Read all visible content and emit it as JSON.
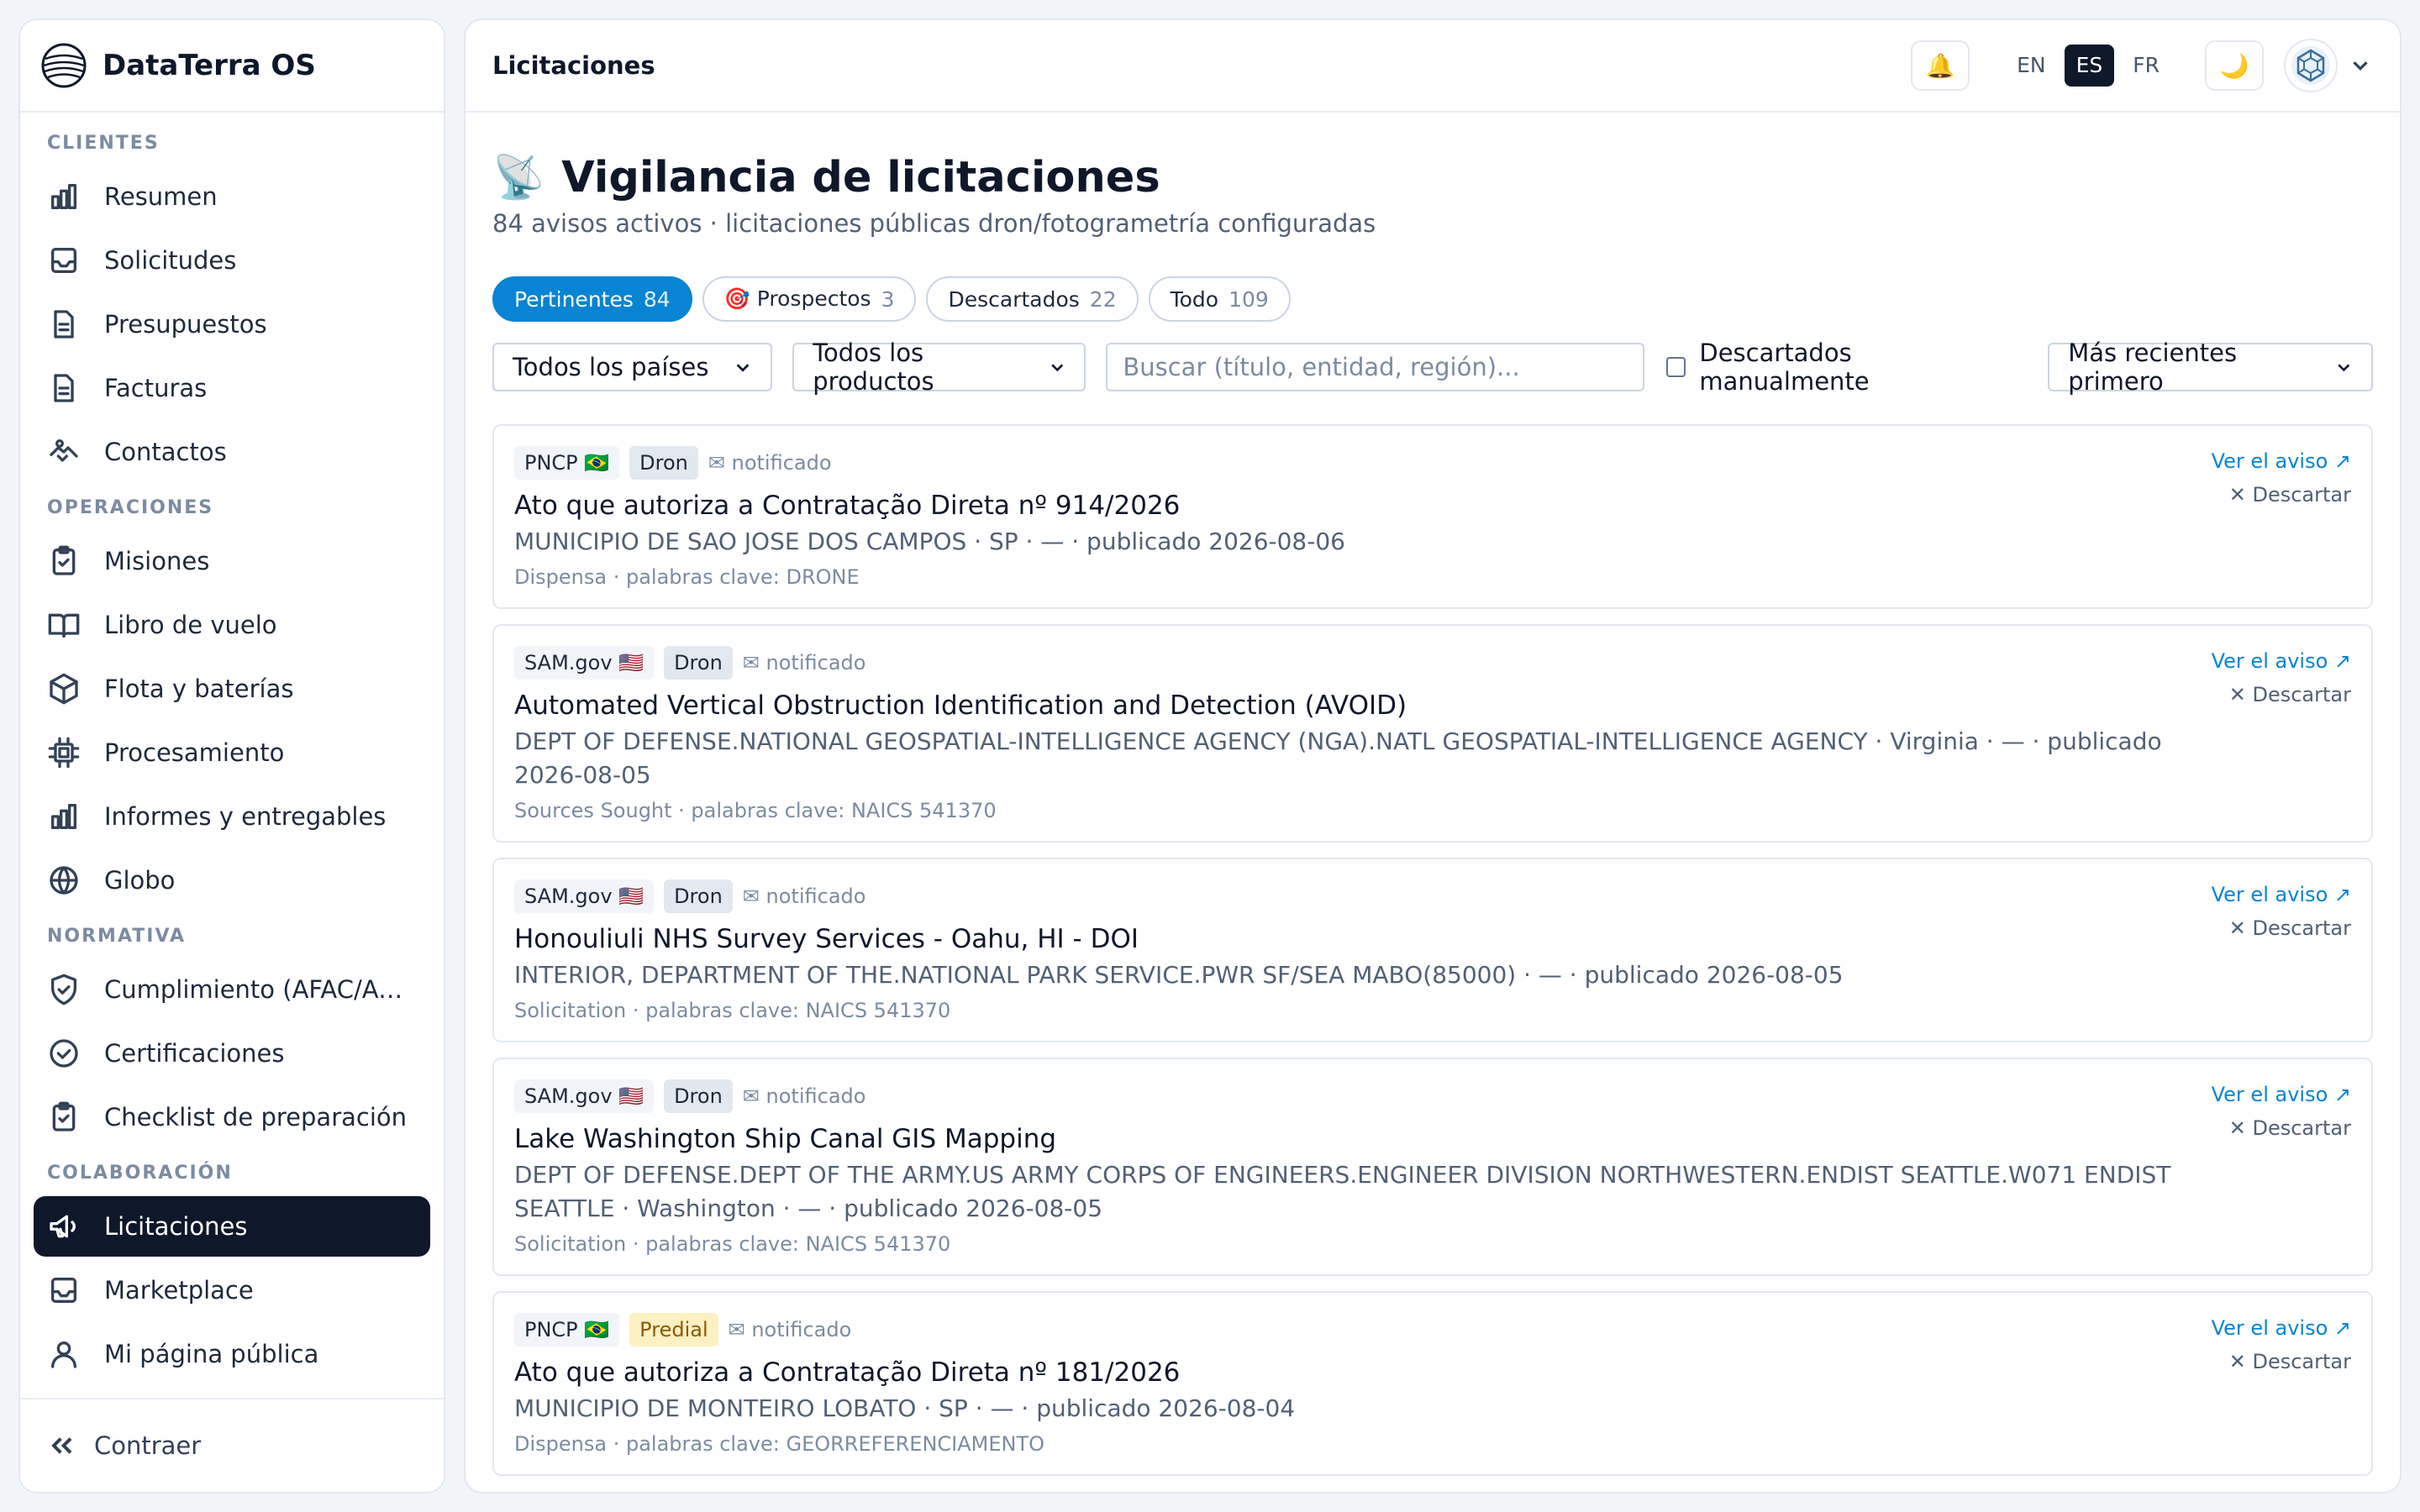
{
  "brand": {
    "name": "DataTerra OS"
  },
  "nav": {
    "sections": [
      {
        "title": "CLIENTES",
        "items": [
          {
            "label": "Resumen",
            "icon": "bar-chart-icon"
          },
          {
            "label": "Solicitudes",
            "icon": "inbox-icon"
          },
          {
            "label": "Presupuestos",
            "icon": "document-icon"
          },
          {
            "label": "Facturas",
            "icon": "document-icon"
          },
          {
            "label": "Contactos",
            "icon": "handshake-icon"
          }
        ]
      },
      {
        "title": "OPERACIONES",
        "items": [
          {
            "label": "Misiones",
            "icon": "clipboard-check-icon"
          },
          {
            "label": "Libro de vuelo",
            "icon": "book-icon"
          },
          {
            "label": "Flota y baterías",
            "icon": "box-icon"
          },
          {
            "label": "Procesamiento",
            "icon": "cpu-icon"
          },
          {
            "label": "Informes y entregables",
            "icon": "bar-chart-icon"
          },
          {
            "label": "Globo",
            "icon": "globe-icon"
          }
        ]
      },
      {
        "title": "NORMATIVA",
        "items": [
          {
            "label": "Cumplimiento (AFAC/Aer...",
            "icon": "shield-check-icon"
          },
          {
            "label": "Certificaciones",
            "icon": "check-circle-icon"
          },
          {
            "label": "Checklist de preparación",
            "icon": "clipboard-check-icon"
          }
        ]
      },
      {
        "title": "COLABORACIÓN",
        "items": [
          {
            "label": "Licitaciones",
            "icon": "megaphone-icon",
            "active": true
          },
          {
            "label": "Marketplace",
            "icon": "inbox-icon"
          },
          {
            "label": "Mi página pública",
            "icon": "user-icon"
          }
        ]
      }
    ],
    "collapse_label": "Contraer"
  },
  "topbar": {
    "title": "Licitaciones",
    "bell": "🔔",
    "languages": [
      "EN",
      "ES",
      "FR"
    ],
    "active_language": "ES",
    "theme": "🌙"
  },
  "page": {
    "emoji": "📡",
    "title": "Vigilancia de licitaciones",
    "subtitle": "84 avisos activos · licitaciones públicas dron/fotogrametría configuradas"
  },
  "tabs": [
    {
      "label": "Pertinentes",
      "count": "84",
      "active": true
    },
    {
      "label": "🎯 Prospectos",
      "count": "3"
    },
    {
      "label": "Descartados",
      "count": "22"
    },
    {
      "label": "Todo",
      "count": "109"
    }
  ],
  "filters": {
    "country": "Todos los países",
    "product": "Todos los productos",
    "search_placeholder": "Buscar (título, entidad, región)...",
    "manual_discard_label": "Descartados manualmente",
    "sort": "Más recientes primero"
  },
  "card_labels": {
    "notified": "✉ notificado",
    "view": "Ver el aviso ↗",
    "discard": "✕ Descartar"
  },
  "results": [
    {
      "source": "PNCP 🇧🇷",
      "product": "Dron",
      "product_kind": "dron",
      "title": "Ato que autoriza a Contratação Direta nº 914/2026",
      "meta": "MUNICIPIO DE SAO JOSE DOS CAMPOS · SP · — · publicado 2026-08-06",
      "foot": "Dispensa · palabras clave: DRONE"
    },
    {
      "source": "SAM.gov 🇺🇸",
      "product": "Dron",
      "product_kind": "dron",
      "title": "Automated Vertical Obstruction Identification and Detection (AVOID)",
      "meta": "DEPT OF DEFENSE.NATIONAL GEOSPATIAL-INTELLIGENCE AGENCY (NGA).NATL GEOSPATIAL-INTELLIGENCE AGENCY · Virginia · — · publicado 2026-08-05",
      "foot": "Sources Sought · palabras clave: NAICS 541370"
    },
    {
      "source": "SAM.gov 🇺🇸",
      "product": "Dron",
      "product_kind": "dron",
      "title": "Honouliuli NHS Survey Services - Oahu, HI - DOI",
      "meta": "INTERIOR, DEPARTMENT OF THE.NATIONAL PARK SERVICE.PWR SF/SEA MABO(85000) · — · publicado 2026-08-05",
      "foot": "Solicitation · palabras clave: NAICS 541370"
    },
    {
      "source": "SAM.gov 🇺🇸",
      "product": "Dron",
      "product_kind": "dron",
      "title": "Lake Washington Ship Canal GIS Mapping",
      "meta": "DEPT OF DEFENSE.DEPT OF THE ARMY.US ARMY CORPS OF ENGINEERS.ENGINEER DIVISION NORTHWESTERN.ENDIST SEATTLE.W071 ENDIST SEATTLE · Washington · — · publicado 2026-08-05",
      "foot": "Solicitation · palabras clave: NAICS 541370"
    },
    {
      "source": "PNCP 🇧🇷",
      "product": "Predial",
      "product_kind": "predial",
      "title": "Ato que autoriza a Contratação Direta nº 181/2026",
      "meta": "MUNICIPIO DE MONTEIRO LOBATO · SP · — · publicado 2026-08-04",
      "foot": "Dispensa · palabras clave: GEORREFERENCIAMENTO"
    }
  ]
}
